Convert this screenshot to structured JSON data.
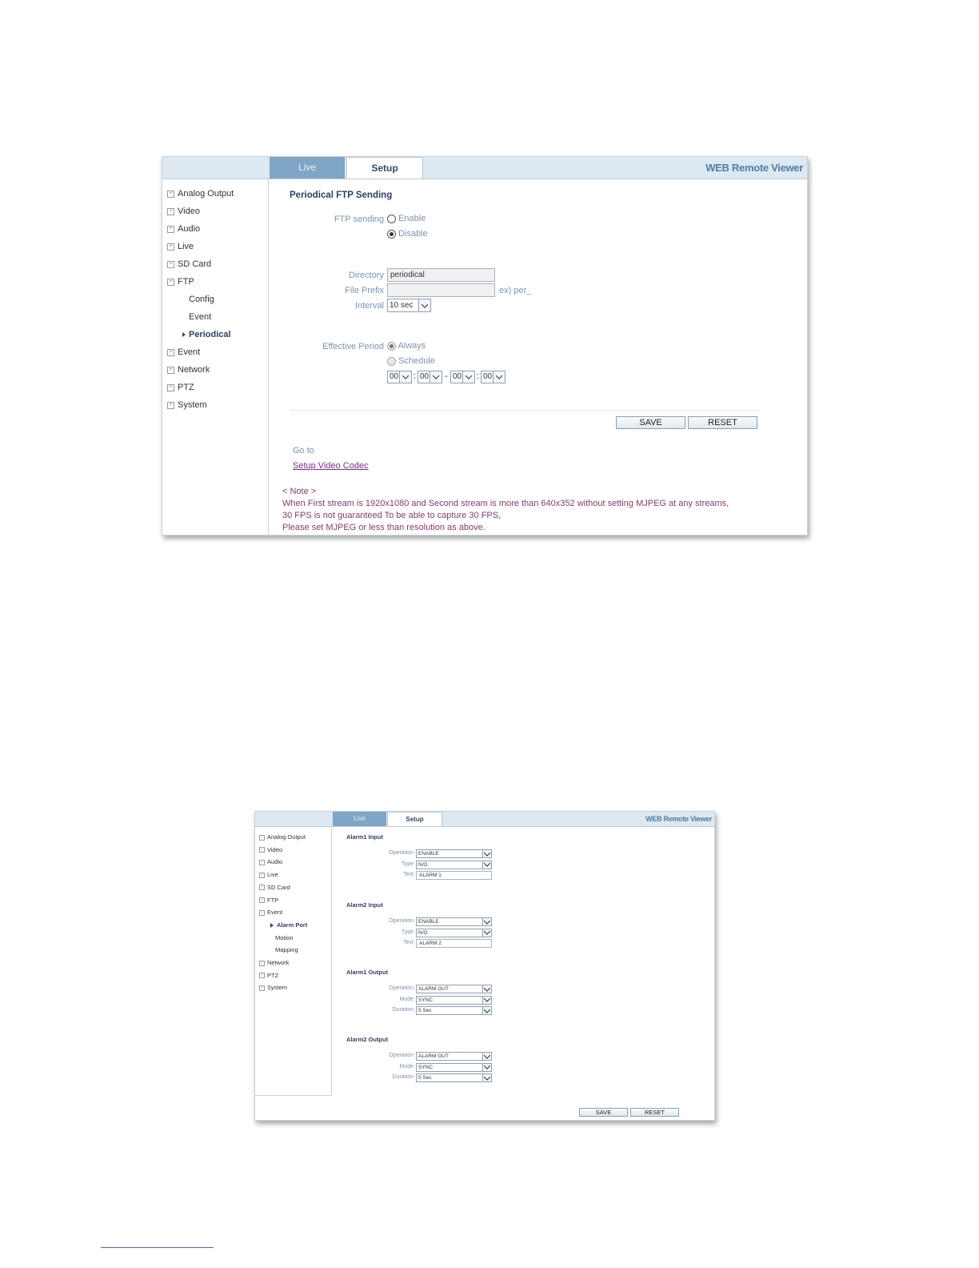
{
  "tabs": {
    "live": "Live",
    "setup": "Setup"
  },
  "brand": "WEB Remote Viewer",
  "shot1": {
    "sidebar": [
      {
        "label": "Analog Output"
      },
      {
        "label": "Video"
      },
      {
        "label": "Audio"
      },
      {
        "label": "Live"
      },
      {
        "label": "SD Card"
      },
      {
        "label": "FTP"
      }
    ],
    "sidebar_sub": [
      {
        "label": "Config",
        "active": false
      },
      {
        "label": "Event",
        "active": false
      },
      {
        "label": "Periodical",
        "active": true
      }
    ],
    "sidebar_after": [
      {
        "label": "Event"
      },
      {
        "label": "Network"
      },
      {
        "label": "PTZ"
      },
      {
        "label": "System"
      }
    ],
    "title": "Periodical FTP Sending",
    "ftp_sending": {
      "label": "FTP sending",
      "enable": "Enable",
      "disable": "Disable",
      "selected": "Disable"
    },
    "directory": {
      "label": "Directory",
      "value": "periodical"
    },
    "file_prefix": {
      "label": "File Prefix",
      "value": "",
      "hint": "ex) per_"
    },
    "interval": {
      "label": "Interval",
      "value": "10 sec"
    },
    "effective_period": {
      "label": "Effective Period",
      "always": "Always",
      "schedule": "Schedule",
      "selected": "Always"
    },
    "schedule_times": [
      "00",
      "00",
      "00",
      "00"
    ],
    "schedule_separators": [
      ":",
      "-",
      ":"
    ],
    "save": "SAVE",
    "reset": "RESET",
    "goto": "Go to",
    "goto_link": "Setup Video Codec",
    "note_title": "< Note >",
    "note_lines": [
      "When First stream is 1920x1080 and Second stream is more than 640x352 without setting MJPEG at any streams,",
      "30 FPS is not guaranteed To be able to capture 30 FPS,",
      "Please set MJPEG or less than resolution as above."
    ]
  },
  "shot2": {
    "sidebar": [
      {
        "label": "Analog Output"
      },
      {
        "label": "Video"
      },
      {
        "label": "Audio"
      },
      {
        "label": "Live"
      },
      {
        "label": "SD Card"
      },
      {
        "label": "FTP"
      },
      {
        "label": "Event"
      }
    ],
    "sidebar_sub": [
      {
        "label": "Alarm Port",
        "active": true
      },
      {
        "label": "Motion",
        "active": false
      },
      {
        "label": "Mapping",
        "active": false
      }
    ],
    "sidebar_after": [
      {
        "label": "Network"
      },
      {
        "label": "PTZ"
      },
      {
        "label": "System"
      }
    ],
    "sections": [
      {
        "title": "Alarm1 Input",
        "rows": [
          {
            "label": "Operation",
            "value": "ENABLE",
            "kind": "select"
          },
          {
            "label": "Type",
            "value": "N/O",
            "kind": "select"
          },
          {
            "label": "Text",
            "value": "ALARM 1",
            "kind": "text"
          }
        ]
      },
      {
        "title": "Alarm2 Input",
        "rows": [
          {
            "label": "Operation",
            "value": "ENABLE",
            "kind": "select"
          },
          {
            "label": "Type",
            "value": "N/O",
            "kind": "select"
          },
          {
            "label": "Text",
            "value": "ALARM 2",
            "kind": "text"
          }
        ]
      },
      {
        "title": "Alarm1 Output",
        "rows": [
          {
            "label": "Operation",
            "value": "ALARM OUT",
            "kind": "select"
          },
          {
            "label": "Mode",
            "value": "SYNC",
            "kind": "select"
          },
          {
            "label": "Duration",
            "value": "5 Sec",
            "kind": "select"
          }
        ]
      },
      {
        "title": "Alarm2 Output",
        "rows": [
          {
            "label": "Operation",
            "value": "ALARM OUT",
            "kind": "select"
          },
          {
            "label": "Mode",
            "value": "SYNC",
            "kind": "select"
          },
          {
            "label": "Duration",
            "value": "5 Sec",
            "kind": "select"
          }
        ]
      }
    ],
    "save": "SAVE",
    "reset": "RESET"
  }
}
